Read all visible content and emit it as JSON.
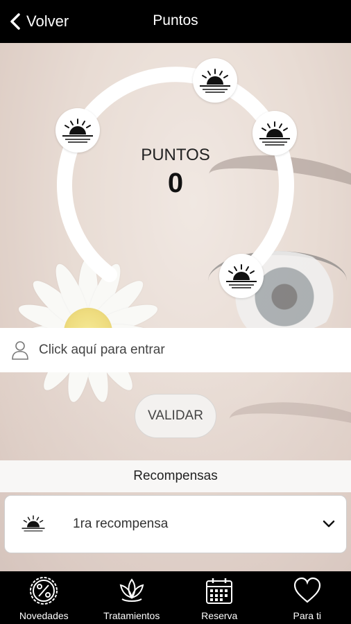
{
  "header": {
    "back_label": "Volver",
    "title": "Puntos"
  },
  "gauge": {
    "points_label": "PUNTOS",
    "points_value": "0",
    "icon": "sunset-icon"
  },
  "login": {
    "label": "Click aquí para entrar",
    "icon": "user-icon"
  },
  "validate_button": {
    "label": "VALIDAR"
  },
  "rewards": {
    "title": "Recompensas",
    "items": [
      {
        "label": "1ra recompensa",
        "icon": "sunset-icon"
      }
    ]
  },
  "bottom_nav": {
    "tabs": [
      {
        "label": "Novedades",
        "icon": "percent-badge-icon"
      },
      {
        "label": "Tratamientos",
        "icon": "lotus-icon"
      },
      {
        "label": "Reserva",
        "icon": "calendar-icon"
      },
      {
        "label": "Para ti",
        "icon": "heart-icon"
      }
    ]
  },
  "colors": {
    "bar_bg": "#000000",
    "surface": "#ffffff",
    "text_dark": "#222222"
  }
}
